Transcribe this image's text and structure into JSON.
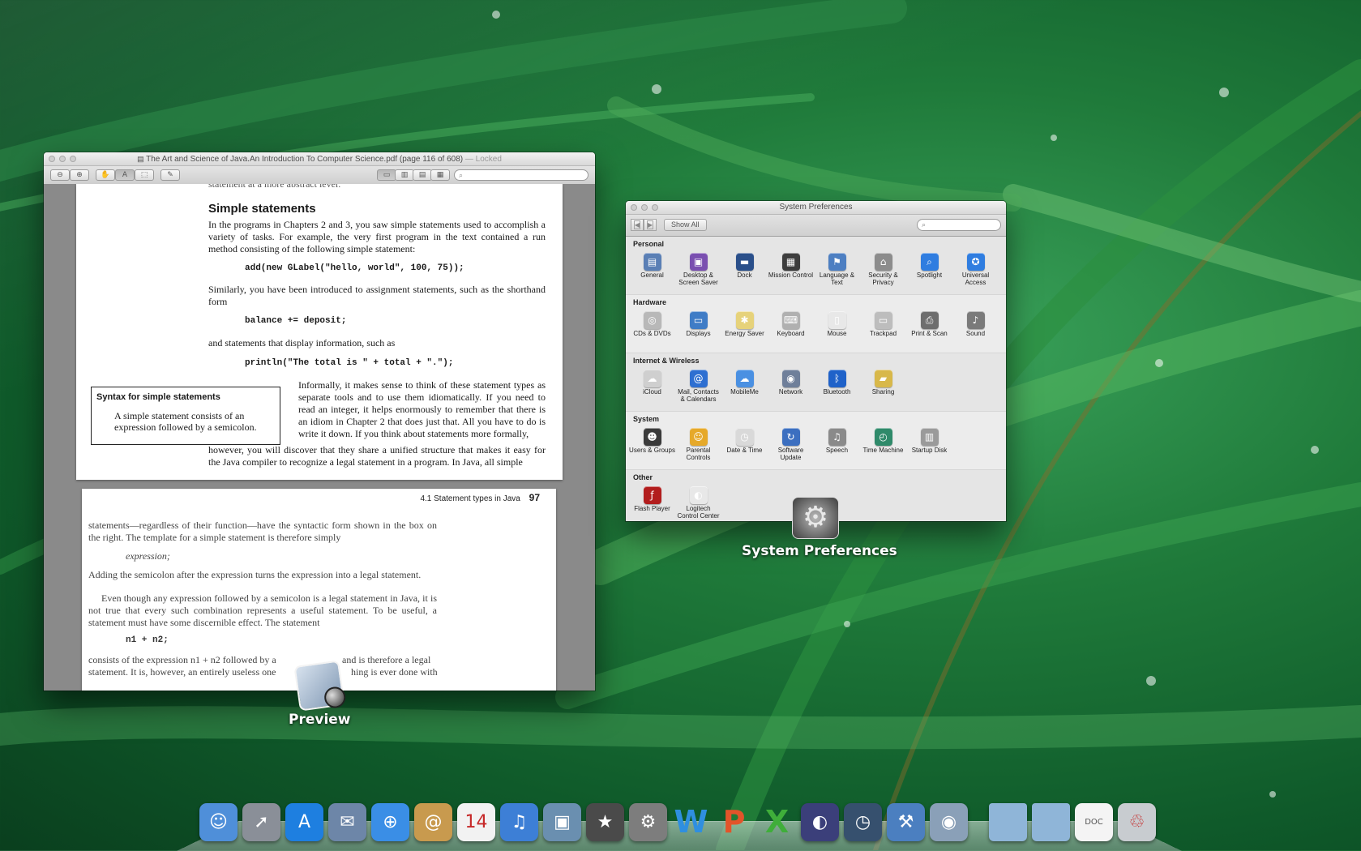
{
  "preview_window": {
    "title": "The Art and Science of Java.An Introduction To Computer Science.pdf (page 116 of 608)",
    "locked": "— Locked",
    "search_placeholder": "",
    "page1": {
      "top_cutoff": "statement at a more abstract level.",
      "heading": "Simple statements",
      "para1": "In the programs in Chapters 2 and 3, you saw simple statements used to accomplish a variety of tasks. For example, the very first program in the text contained a run method consisting of the following simple statement:",
      "code1": "add(new GLabel(\"hello, world\", 100, 75));",
      "para2": "Similarly, you have been introduced to assignment statements, such as the shorthand form",
      "code2": "balance += deposit;",
      "para3": "and statements that display information, such as",
      "code3": "println(\"The total is \" + total + \".\");",
      "syntax_title": "Syntax for simple statements",
      "syntax_body": "A simple statement consists of an expression followed by a semicolon.",
      "para4": "Informally, it makes sense to think of these statement types as separate tools and to use them idiomatically. If you need to read an integer, it helps enormously to remember that there is an idiom in Chapter 2 that does just that. All you have to do is write it down. If you think about statements more formally,",
      "para5": "however, you will discover that they share a unified structure that makes it easy for the Java compiler to recognize a legal statement in a program. In Java, all simple"
    },
    "page2": {
      "header": "4.1 Statement types in Java",
      "page_number": "97",
      "para1": "statements—regardless of their function—have the syntactic form shown in the box on the right. The template for a simple statement is therefore simply",
      "template": "expression;",
      "para2": "Adding the semicolon after the expression turns the expression into a legal statement.",
      "para3": "Even though any expression followed by a semicolon is a legal statement in Java, it is not true that every such combination represents a useful statement. To be useful, a statement must have some discernible effect. The statement",
      "code": "n1 + n2;",
      "para4_a": "consists of the expression n1 + n2 followed by a",
      "para4_b": "and is therefore a legal",
      "para5_a": "statement. It is, however, an entirely useless one",
      "para5_b": "hing is ever done with"
    },
    "app_label": "Preview"
  },
  "sysprefs_window": {
    "title": "System Preferences",
    "show_all": "Show All",
    "sections": [
      {
        "title": "Personal",
        "items": [
          {
            "label": "General",
            "icon": "general-icon",
            "color": "#5a7fb5",
            "glyph": "▤"
          },
          {
            "label": "Desktop & Screen Saver",
            "icon": "desktop-icon",
            "color": "#7a4fb0",
            "glyph": "▣"
          },
          {
            "label": "Dock",
            "icon": "dock-icon",
            "color": "#2a4f8a",
            "glyph": "▬"
          },
          {
            "label": "Mission Control",
            "icon": "mission-control-icon",
            "color": "#3d3d3d",
            "glyph": "▦"
          },
          {
            "label": "Language & Text",
            "icon": "language-icon",
            "color": "#4d7fc2",
            "glyph": "⚑"
          },
          {
            "label": "Security & Privacy",
            "icon": "security-icon",
            "color": "#8c8c8c",
            "glyph": "⌂"
          },
          {
            "label": "Spotlight",
            "icon": "spotlight-icon",
            "color": "#2f7de0",
            "glyph": "⌕"
          },
          {
            "label": "Universal Access",
            "icon": "universal-access-icon",
            "color": "#2f7de0",
            "glyph": "✪"
          }
        ]
      },
      {
        "title": "Hardware",
        "items": [
          {
            "label": "CDs & DVDs",
            "icon": "cd-icon",
            "color": "#b8b8b8",
            "glyph": "◎"
          },
          {
            "label": "Displays",
            "icon": "displays-icon",
            "color": "#3f7cc6",
            "glyph": "▭"
          },
          {
            "label": "Energy Saver",
            "icon": "energy-saver-icon",
            "color": "#e6d27a",
            "glyph": "✱"
          },
          {
            "label": "Keyboard",
            "icon": "keyboard-icon",
            "color": "#b0b0b0",
            "glyph": "⌨"
          },
          {
            "label": "Mouse",
            "icon": "mouse-icon",
            "color": "#e8e8e8",
            "glyph": "▯"
          },
          {
            "label": "Trackpad",
            "icon": "trackpad-icon",
            "color": "#bdbdbd",
            "glyph": "▭"
          },
          {
            "label": "Print & Scan",
            "icon": "print-icon",
            "color": "#6e6e6e",
            "glyph": "⎙"
          },
          {
            "label": "Sound",
            "icon": "sound-icon",
            "color": "#7a7a7a",
            "glyph": "♪"
          }
        ]
      },
      {
        "title": "Internet & Wireless",
        "items": [
          {
            "label": "iCloud",
            "icon": "icloud-icon",
            "color": "#cfcfcf",
            "glyph": "☁"
          },
          {
            "label": "Mail, Contacts & Calendars",
            "icon": "mail-icon",
            "color": "#2e6fd1",
            "glyph": "@"
          },
          {
            "label": "MobileMe",
            "icon": "mobileme-icon",
            "color": "#4a90e2",
            "glyph": "☁"
          },
          {
            "label": "Network",
            "icon": "network-icon",
            "color": "#6f7f9a",
            "glyph": "◉"
          },
          {
            "label": "Bluetooth",
            "icon": "bluetooth-icon",
            "color": "#1f62c9",
            "glyph": "ᛒ"
          },
          {
            "label": "Sharing",
            "icon": "sharing-icon",
            "color": "#d8b84a",
            "glyph": "▰"
          }
        ]
      },
      {
        "title": "System",
        "items": [
          {
            "label": "Users & Groups",
            "icon": "users-icon",
            "color": "#3a3a3a",
            "glyph": "☻"
          },
          {
            "label": "Parental Controls",
            "icon": "parental-icon",
            "color": "#e6a92a",
            "glyph": "☺"
          },
          {
            "label": "Date & Time",
            "icon": "date-time-icon",
            "color": "#d9d9d9",
            "glyph": "◷"
          },
          {
            "label": "Software Update",
            "icon": "software-update-icon",
            "color": "#3c6fc0",
            "glyph": "↻"
          },
          {
            "label": "Speech",
            "icon": "speech-icon",
            "color": "#8a8a8a",
            "glyph": "♫"
          },
          {
            "label": "Time Machine",
            "icon": "time-machine-icon",
            "color": "#2f8a6a",
            "glyph": "◴"
          },
          {
            "label": "Startup Disk",
            "icon": "startup-disk-icon",
            "color": "#9a9a9a",
            "glyph": "▥"
          }
        ]
      },
      {
        "title": "Other",
        "items": [
          {
            "label": "Flash Player",
            "icon": "flash-icon",
            "color": "#b21d1d",
            "glyph": "ƒ"
          },
          {
            "label": "Logitech Control Center",
            "icon": "logitech-icon",
            "color": "#e8e8e8",
            "glyph": "◐"
          }
        ]
      }
    ],
    "app_label": "System Preferences"
  },
  "dock": {
    "items": [
      {
        "name": "finder",
        "icon": "finder-icon",
        "color": "#4f8fd9",
        "glyph": "☺"
      },
      {
        "name": "launchpad",
        "icon": "launchpad-icon",
        "color": "#8a8f98",
        "glyph": "➚"
      },
      {
        "name": "app-store",
        "icon": "app-store-icon",
        "color": "#1e7fe0",
        "glyph": "A"
      },
      {
        "name": "mail-stamp",
        "icon": "mail-stamp-icon",
        "color": "#6d86a8",
        "glyph": "✉"
      },
      {
        "name": "safari",
        "icon": "safari-icon",
        "color": "#3a8ee6",
        "glyph": "⊕"
      },
      {
        "name": "address-book",
        "icon": "address-book-icon",
        "color": "#c89a4e",
        "glyph": "@"
      },
      {
        "name": "calendar",
        "icon": "calendar-icon",
        "color": "#f2f2f2",
        "glyph": "14"
      },
      {
        "name": "itunes",
        "icon": "itunes-icon",
        "color": "#3d7fd6",
        "glyph": "♫"
      },
      {
        "name": "iphoto",
        "icon": "iphoto-icon",
        "color": "#6a8fb0",
        "glyph": "▣"
      },
      {
        "name": "imovie",
        "icon": "imovie-icon",
        "color": "#4a4a4a",
        "glyph": "★"
      },
      {
        "name": "system-preferences",
        "icon": "system-preferences-icon",
        "color": "#7d7d7d",
        "glyph": "⚙"
      },
      {
        "name": "word",
        "icon": "word-icon",
        "color": "transparent",
        "glyph": "W",
        "text": "#2f8fe0"
      },
      {
        "name": "powerpoint",
        "icon": "powerpoint-icon",
        "color": "transparent",
        "glyph": "P",
        "text": "#e2542a"
      },
      {
        "name": "excel",
        "icon": "excel-icon",
        "color": "transparent",
        "glyph": "X",
        "text": "#3fae3a"
      },
      {
        "name": "eclipse",
        "icon": "eclipse-icon",
        "color": "#3b3f7a",
        "glyph": "◐"
      },
      {
        "name": "time-machine",
        "icon": "time-machine-dock-icon",
        "color": "#36506e",
        "glyph": "◷"
      },
      {
        "name": "xcode",
        "icon": "xcode-icon",
        "color": "#4b7fc0",
        "glyph": "⚒"
      },
      {
        "name": "preview",
        "icon": "preview-dock-icon",
        "color": "#8aa0b8",
        "glyph": "◉"
      }
    ],
    "right_items": [
      {
        "name": "applications-folder",
        "icon": "folder-icon",
        "color": "#8fb5d8",
        "glyph": ""
      },
      {
        "name": "documents-folder",
        "icon": "folder-icon",
        "color": "#8fb5d8",
        "glyph": ""
      },
      {
        "name": "doc-file",
        "icon": "document-icon",
        "color": "#f4f4f4",
        "glyph": "DOC"
      },
      {
        "name": "trash",
        "icon": "trash-icon",
        "color": "#c8ccd0",
        "glyph": "♲"
      }
    ]
  }
}
